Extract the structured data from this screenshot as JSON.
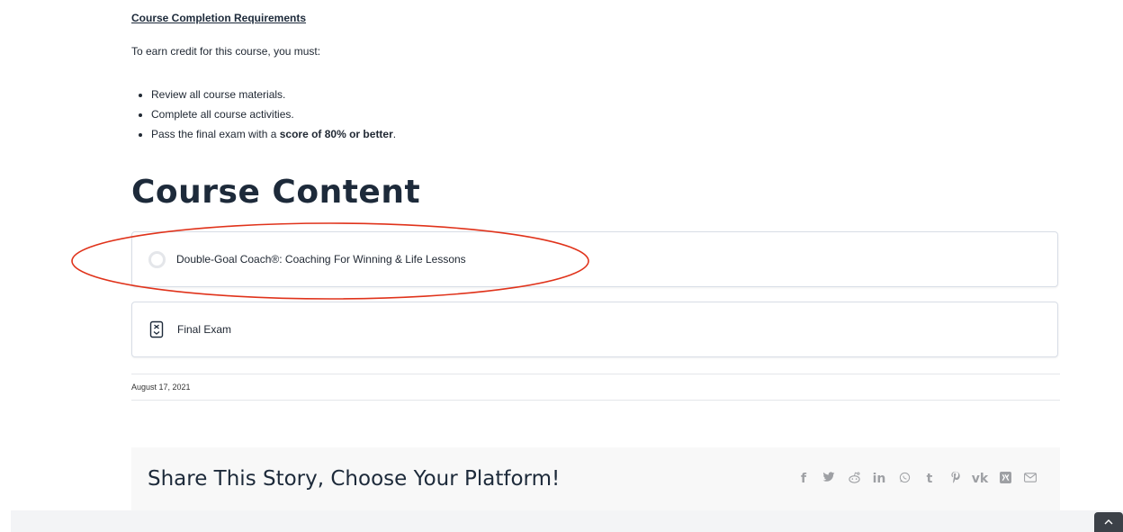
{
  "requirements": {
    "title": "Course Completion Requirements",
    "intro": "To earn credit for this course, you must:",
    "items": [
      {
        "text": "Review all course materials."
      },
      {
        "text": "Complete all course activities."
      },
      {
        "prefix": "Pass the final exam with a ",
        "bold": "score of 80% or better",
        "suffix": "."
      }
    ]
  },
  "course_content": {
    "heading": "Course Content",
    "lessons": [
      {
        "label": "Double-Goal Coach®: Coaching For Winning & Life Lessons",
        "icon": "status-circle-icon"
      },
      {
        "label": "Final Exam",
        "icon": "quiz-icon"
      }
    ]
  },
  "meta": {
    "date": "August 17, 2021"
  },
  "share": {
    "title": "Share This Story, Choose Your Platform!",
    "platforms": [
      {
        "name": "facebook",
        "glyph": "f"
      },
      {
        "name": "twitter",
        "glyph": "🐦"
      },
      {
        "name": "reddit",
        "glyph": "☺"
      },
      {
        "name": "linkedin",
        "glyph": "in"
      },
      {
        "name": "whatsapp",
        "glyph": "✆"
      },
      {
        "name": "tumblr",
        "glyph": "t"
      },
      {
        "name": "pinterest",
        "glyph": "℘"
      },
      {
        "name": "vk",
        "glyph": "vk"
      },
      {
        "name": "xing",
        "glyph": "X"
      },
      {
        "name": "email",
        "glyph": "✉"
      }
    ]
  },
  "scroll_top": {
    "glyph": "^"
  },
  "colors": {
    "heading": "#1d2a3a",
    "annotation": "#e0331b",
    "icon_gray": "#9ea0a4"
  }
}
